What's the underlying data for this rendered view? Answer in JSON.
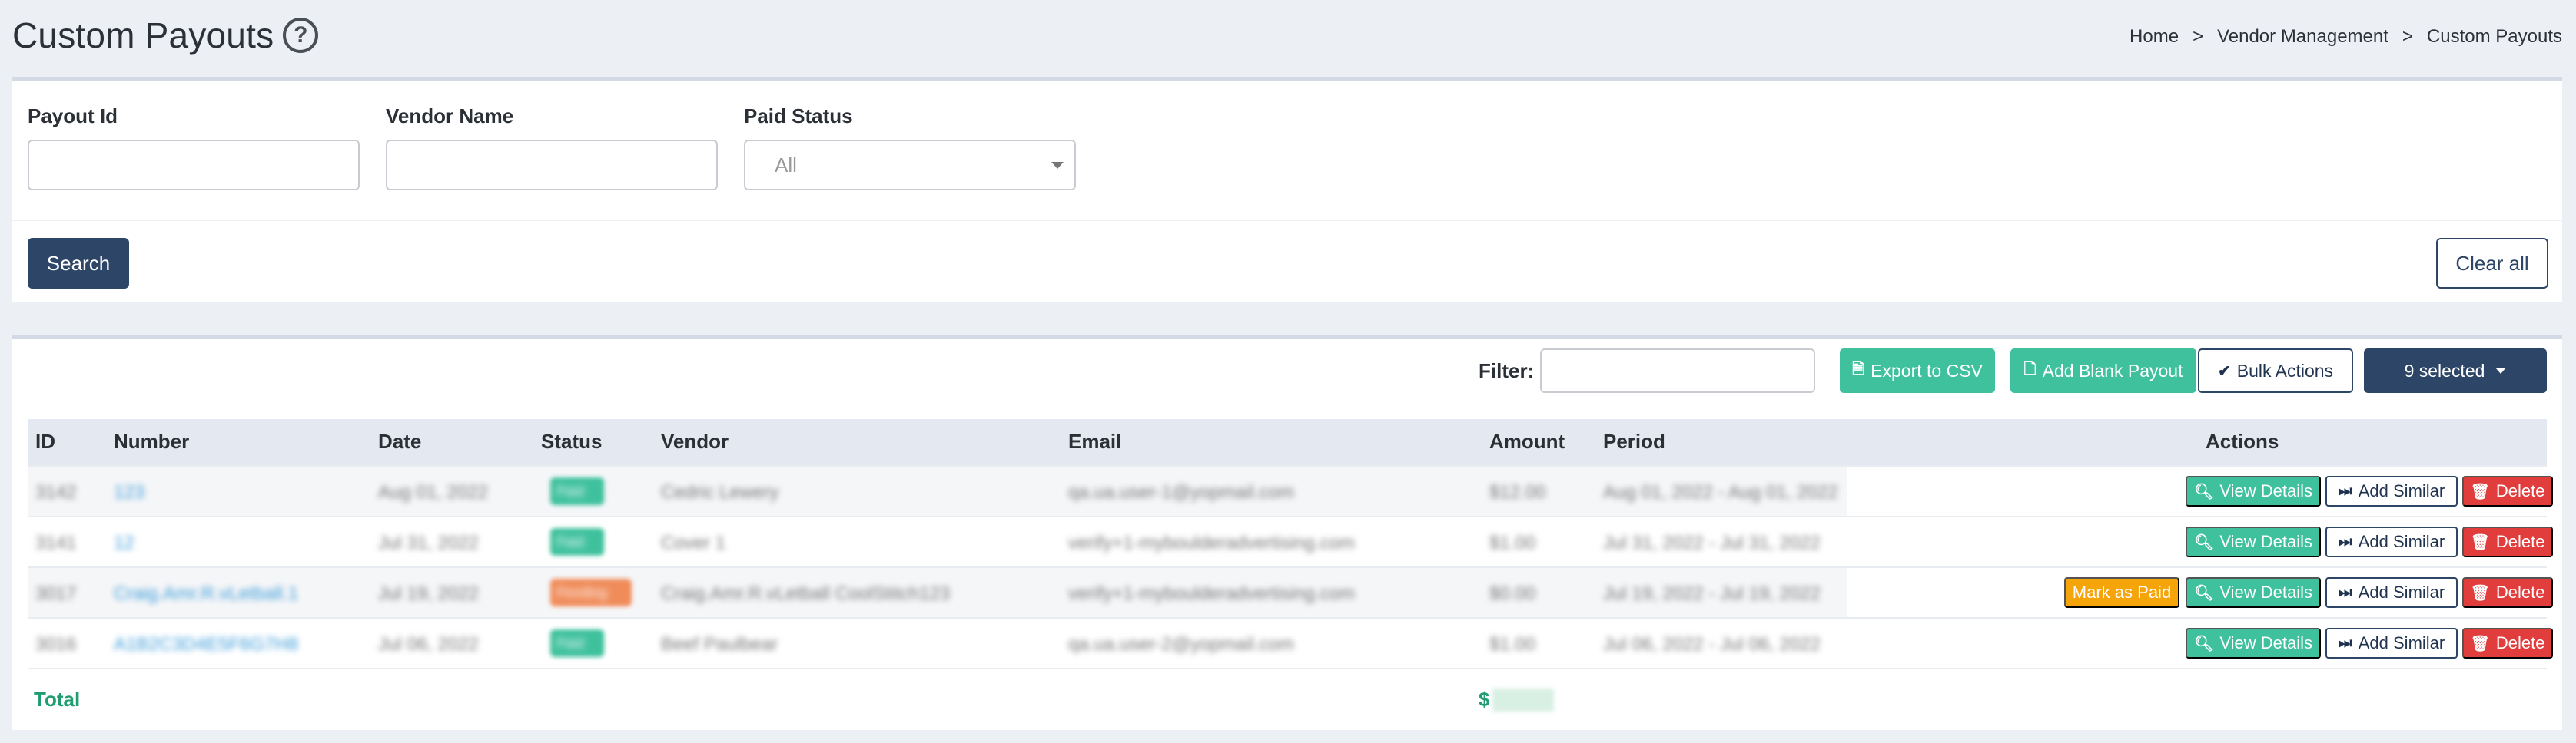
{
  "header": {
    "title": "Custom Payouts",
    "help_icon": "?",
    "breadcrumb": [
      "Home",
      "Vendor Management",
      "Custom Payouts"
    ],
    "breadcrumb_sep": ">"
  },
  "search_form": {
    "payout_id": {
      "label": "Payout Id",
      "value": "",
      "placeholder": ""
    },
    "vendor_name": {
      "label": "Vendor Name",
      "value": "",
      "placeholder": ""
    },
    "paid_status": {
      "label": "Paid Status",
      "selected": "All"
    },
    "search_label": "Search",
    "clear_label": "Clear all"
  },
  "toolbar": {
    "filter_label": "Filter:",
    "filter_value": "",
    "export_label": "Export to CSV",
    "add_blank_label": "Add Blank Payout",
    "bulk_label": "Bulk Actions",
    "selected_label": "9 selected"
  },
  "table": {
    "columns": [
      "ID",
      "Number",
      "Date",
      "Status",
      "Vendor",
      "Email",
      "Amount",
      "Period",
      "Actions"
    ],
    "rows": [
      {
        "id": "3142",
        "number": "123",
        "date": "Aug 01, 2022",
        "status": "Paid",
        "vendor": "Cedric Lewery",
        "email": "qa.ua.user-1@yopmail.com",
        "amount": "$12.00",
        "period": "Aug 01, 2022 - Aug 01, 2022",
        "mark_paid": false
      },
      {
        "id": "3141",
        "number": "12",
        "date": "Jul 31, 2022",
        "status": "Paid",
        "vendor": "Cover 1",
        "email": "verify+1-myboulderadvertising.com",
        "amount": "$1.00",
        "period": "Jul 31, 2022 - Jul 31, 2022",
        "mark_paid": false
      },
      {
        "id": "3017",
        "number": "Craig.Amr.R.vLetball.1",
        "date": "Jul 19, 2022",
        "status": "Pending",
        "vendor": "Craig.Amr.R.vLetball CoolStitch123",
        "email": "verify+1-myboulderadvertising.com",
        "amount": "$0.00",
        "period": "Jul 19, 2022 - Jul 19, 2022",
        "mark_paid": true
      },
      {
        "id": "3016",
        "number": "A1B2C3D4E5F6G7H8",
        "date": "Jul 06, 2022",
        "status": "Paid",
        "vendor": "Beef Paulbear",
        "email": "qa.ua.user-2@yopmail.com",
        "amount": "$1.00",
        "period": "Jul 06, 2022 - Jul 06, 2022",
        "mark_paid": false
      }
    ],
    "actions": {
      "view": "View Details",
      "similar": "Add Similar",
      "delete": "Delete",
      "mark_paid": "Mark as Paid"
    },
    "total_label": "Total",
    "total_currency": "$"
  },
  "colors": {
    "primary": "#2d4566",
    "teal": "#3fc19d",
    "danger": "#e23d3d",
    "warning": "#f5a40a",
    "total_green": "#1f9d70"
  }
}
